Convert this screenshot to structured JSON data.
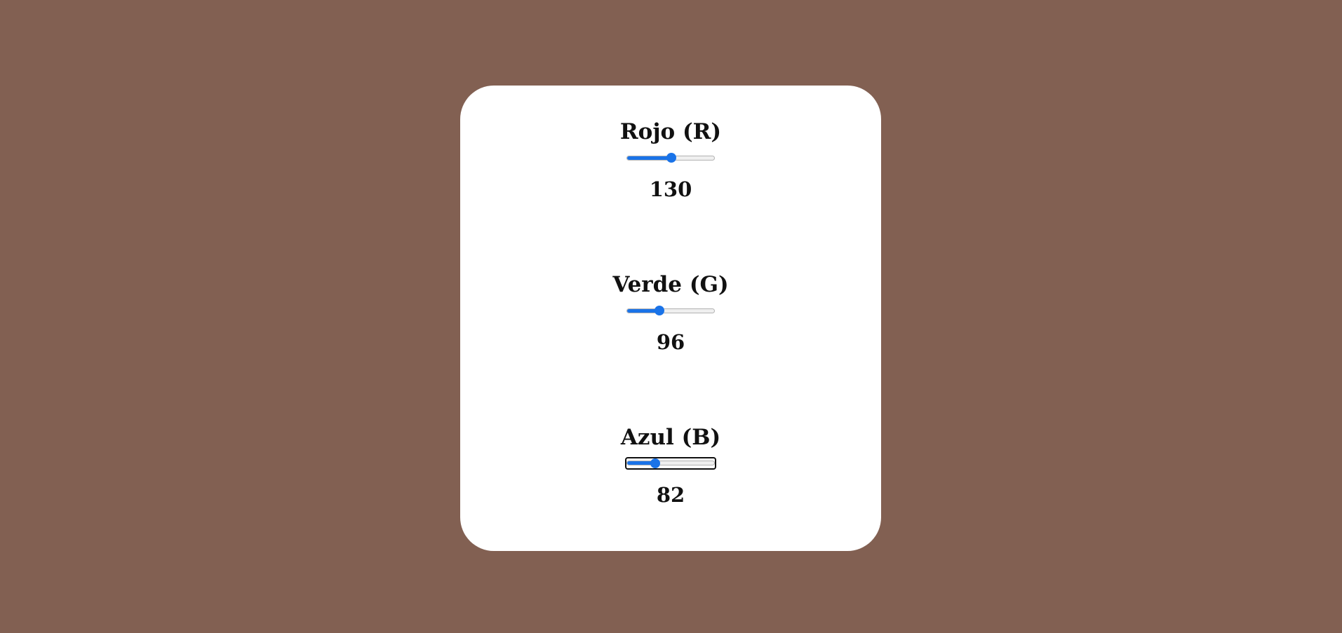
{
  "colors": {
    "background": "#826052",
    "card": "#ffffff",
    "slider_accent": "#1a73e8"
  },
  "sliders": [
    {
      "label": "Rojo (R)",
      "value": "130",
      "min": 0,
      "max": 255,
      "fraction": 0.51
    },
    {
      "label": "Verde (G)",
      "value": "96",
      "min": 0,
      "max": 255,
      "fraction": 0.376
    },
    {
      "label": "Azul (B)",
      "value": "82",
      "min": 0,
      "max": 255,
      "fraction": 0.322,
      "focused": true
    }
  ]
}
